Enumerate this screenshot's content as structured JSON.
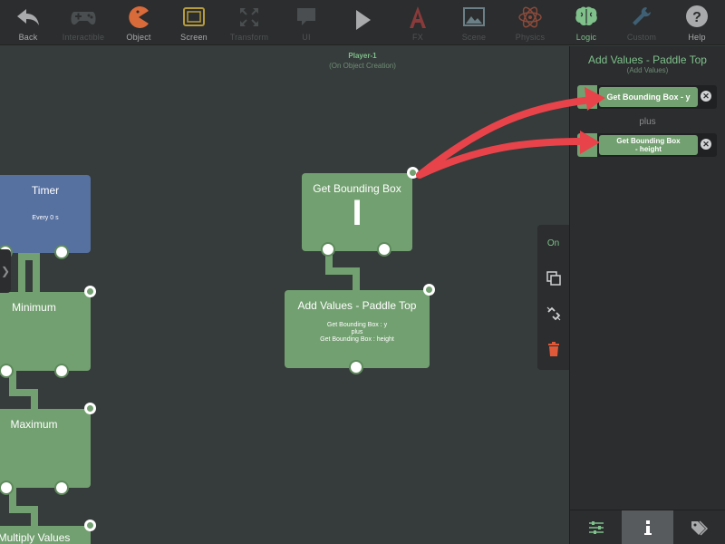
{
  "toolbar": {
    "items": [
      {
        "label": "Back",
        "icon": "back-arrow-icon"
      },
      {
        "label": "Interactible",
        "icon": "gamepad-icon"
      },
      {
        "label": "Object",
        "icon": "pacman-icon"
      },
      {
        "label": "Screen",
        "icon": "screen-icon"
      },
      {
        "label": "Transform",
        "icon": "arrows-expand-icon"
      },
      {
        "label": "UI",
        "icon": "speech-bubble-icon"
      },
      {
        "label": "",
        "icon": "play-icon"
      },
      {
        "label": "FX",
        "icon": "fx-icon"
      },
      {
        "label": "Scene",
        "icon": "image-icon"
      },
      {
        "label": "Physics",
        "icon": "atom-icon"
      },
      {
        "label": "Logic",
        "icon": "brain-icon"
      },
      {
        "label": "Custom",
        "icon": "wrench-icon"
      },
      {
        "label": "Help",
        "icon": "help-icon"
      }
    ]
  },
  "canvas": {
    "scene_title": "Player-1",
    "scene_subtitle": "(On Object Creation)",
    "blocks": {
      "timer": {
        "title": "Timer",
        "body": "Every 0 s"
      },
      "minimum": {
        "title": "Minimum"
      },
      "maximum": {
        "title": "Maximum"
      },
      "multiply": {
        "title": "Multiply Values"
      },
      "bbox": {
        "title": "Get Bounding Box",
        "glyph": "I"
      },
      "add": {
        "title": "Add Values - Paddle Top",
        "body_line1": "Get Bounding Box : y",
        "body_line2": "plus",
        "body_line3": "Get Bounding Box : height"
      }
    }
  },
  "tools": {
    "on_label": "On"
  },
  "panel": {
    "title": "Add Values - Paddle Top",
    "subtitle": "(Add Values)",
    "param1": "Get Bounding Box - y",
    "operator": "plus",
    "param2_line1": "Get Bounding Box",
    "param2_line2": "- height"
  },
  "colors": {
    "accent_green": "#7fc08b",
    "block_green": "#72a070",
    "block_blue": "#5670a0",
    "arrow_red": "#e8434a"
  }
}
